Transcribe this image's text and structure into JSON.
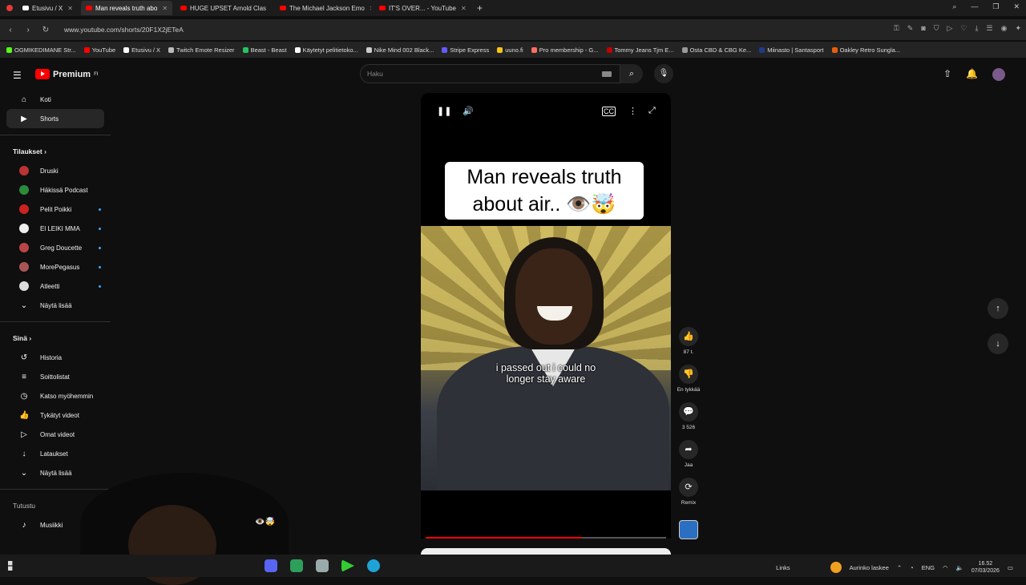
{
  "browser": {
    "tabs": [
      {
        "label": "Etusivu / X",
        "color": "#ffffff",
        "active": false
      },
      {
        "label": "Man reveals truth abo",
        "color": "#ff0000",
        "active": true
      },
      {
        "label": "HUGE UPSET Arnold Clas",
        "color": "#ff0000",
        "active": false
      },
      {
        "label": "The Michael Jackson Emo",
        "color": "#ff0000",
        "active": false
      },
      {
        "label": "IT'S OVER... - YouTube",
        "color": "#ff0000",
        "active": false
      }
    ],
    "url": "www.youtube.com/shorts/20F1X2jETeA",
    "bookmarks": [
      {
        "label": "OGMIKEDIMANE Str...",
        "color": "#53fc18"
      },
      {
        "label": "YouTube",
        "color": "#ff0000"
      },
      {
        "label": "Etusivu / X",
        "color": "#ffffff"
      },
      {
        "label": "Twitch Emote Resizer",
        "color": "#bbbbbb"
      },
      {
        "label": "Beast - Beast",
        "color": "#22c55e"
      },
      {
        "label": "Käytetyt pelitietoko...",
        "color": "#ffffff"
      },
      {
        "label": "Nike Mind 002 Black...",
        "color": "#cccccc"
      },
      {
        "label": "Stripe Express",
        "color": "#635bff"
      },
      {
        "label": "uuno.fi",
        "color": "#f5c518"
      },
      {
        "label": "Pro membership - G...",
        "color": "#ff6f61"
      },
      {
        "label": "Tommy Jeans Tjm E...",
        "color": "#c00000"
      },
      {
        "label": "Osta CBD & CBG Ke...",
        "color": "#999999"
      },
      {
        "label": "Miinasto | Santasport",
        "color": "#1e3a8a"
      },
      {
        "label": "Oakley Retro Sungla...",
        "color": "#e85d0c"
      }
    ]
  },
  "header": {
    "logo": "Premium",
    "logo_country": "FI",
    "search_placeholder": "Haku"
  },
  "sidebar": {
    "main": [
      {
        "label": "Koti",
        "icon": "home-icon",
        "glyph": "⌂"
      },
      {
        "label": "Shorts",
        "icon": "shorts-icon",
        "glyph": "▶"
      }
    ],
    "subscriptions_title": "Tilaukset",
    "subscriptions": [
      {
        "label": "Druski",
        "color": "#b33"
      },
      {
        "label": "Häkissä Podcast",
        "color": "#2a8c3a"
      },
      {
        "label": "Pelit Poikki",
        "color": "#c22"
      },
      {
        "label": "El LEIKI MMA",
        "color": "#eee"
      },
      {
        "label": "Greg Doucette",
        "color": "#b44"
      },
      {
        "label": "MorePegasus",
        "color": "#a55"
      },
      {
        "label": "Atleetti",
        "color": "#ddd"
      }
    ],
    "show_more": "Näytä lisää",
    "you_title": "Sinä",
    "you": [
      {
        "label": "Historia",
        "glyph": "↺"
      },
      {
        "label": "Soittolistat",
        "glyph": "≡"
      },
      {
        "label": "Katso myöhemmin",
        "glyph": "◷"
      },
      {
        "label": "Tykätyt videot",
        "glyph": "👍"
      },
      {
        "label": "Omat videot",
        "glyph": "▷"
      },
      {
        "label": "Lataukset",
        "glyph": "↓"
      }
    ],
    "show_more_2": "Näytä lisää",
    "explore_title": "Tutustu",
    "explore": [
      {
        "label": "Musiikki",
        "glyph": "♪"
      }
    ]
  },
  "player": {
    "title_card": "Man reveals truth about air.. 👁️🤯",
    "subtitle_line1": "i passed out i could no",
    "subtitle_line2": "longer stay aware",
    "progress": 0.65
  },
  "actions": {
    "likes": "87 t.",
    "dislike": "En tykkää",
    "comments": "3 526",
    "share": "Jaa",
    "remix": "Remix"
  },
  "overlay": {
    "emojis": "👁️🤯"
  },
  "taskbar": {
    "links": "Links",
    "weather": "Aurinko laskee",
    "lang": "ENG",
    "time": "16.52",
    "date": "07/03/2026"
  }
}
